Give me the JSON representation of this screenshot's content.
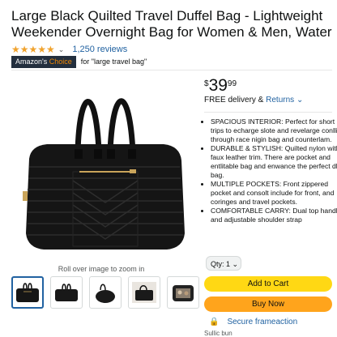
{
  "product": {
    "title_line1": "Large Black Quilted Travel Duffel Bag - Lightweight",
    "title_line2": "Weekender Overnight Bag for Women & Men, Water-",
    "stars": "★★★★★",
    "rating_value": 4.5,
    "reviews": "1,250 reviews",
    "badge_prefix": "Amazon's",
    "badge_suffix": "Choice",
    "badge_for": "for \"large travel bag\""
  },
  "gallery": {
    "rollover_text": "Roll over image to zoom in",
    "thumb_count": 5,
    "selected_index": 0
  },
  "buybox": {
    "price_symbol": "$",
    "price_whole": "39",
    "price_fraction": "99",
    "delivery_prefix": "FREE delivery & ",
    "delivery_returns": "Returns",
    "returns_chevron": "⌄",
    "qty_label": "Qty: 1",
    "qty_chevron": "⌄",
    "add_to_cart": "Add to Cart",
    "buy_now": "Buy Now",
    "secure": "Secure frameaction",
    "sold_by": "Sullic bun"
  },
  "bullets": [
    "SPACIOUS INTERIOR: Perfect for short trips to echarge slote and revelarge conllins through race nigin bag and counterlam.",
    "DURABLE & STYLISH: Quilted nylon with faux leather trim. There are pocket and entlitable bag and enwance the perfect dly bag.",
    "MULTIPLE POCKETS: Front zippered pocket and consolt include for front, and coringes and travel pockets.",
    "COMFORTABLE CARRY: Dual top handles and adjustable shoulder strap"
  ],
  "colors": {
    "star": "#f0a22c",
    "link": "#2162a1",
    "add_to_cart": "#ffd814",
    "buy_now": "#ffa41c",
    "badge_bg": "#232f3e",
    "badge_accent": "#f08804"
  },
  "icons": {
    "rating": "star-icon",
    "dropdown": "chevron-down-icon",
    "secure": "lock-icon"
  }
}
